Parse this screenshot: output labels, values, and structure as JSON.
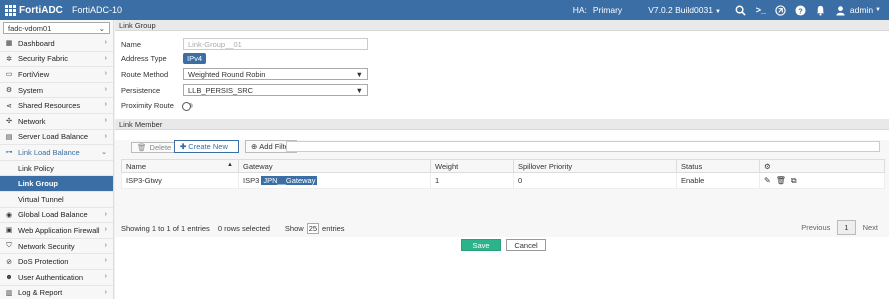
{
  "header": {
    "brand": "FortiADC",
    "product": "FortiADC-10",
    "ha_label": "HA:",
    "ha_value": "Primary",
    "version": "V7.0.2 Build0031",
    "user": "admin"
  },
  "sidebar": {
    "vdom": "fadc-vdom01",
    "items": [
      {
        "label": "Dashboard",
        "icon": "dashboard-icon"
      },
      {
        "label": "Security Fabric",
        "icon": "security-fabric-icon"
      },
      {
        "label": "FortiView",
        "icon": "fortiview-icon"
      },
      {
        "label": "System",
        "icon": "gear-icon"
      },
      {
        "label": "Shared Resources",
        "icon": "share-icon"
      },
      {
        "label": "Network",
        "icon": "network-icon"
      },
      {
        "label": "Server Load Balance",
        "icon": "server-icon"
      },
      {
        "label": "Link Load Balance",
        "icon": "link-icon"
      }
    ],
    "subitems": [
      {
        "label": "Link Policy"
      },
      {
        "label": "Link Group"
      },
      {
        "label": "Virtual Tunnel"
      }
    ],
    "items_after": [
      {
        "label": "Global Load Balance",
        "icon": "globe-icon"
      },
      {
        "label": "Web Application Firewall",
        "icon": "waf-icon"
      },
      {
        "label": "Network Security",
        "icon": "shield-icon"
      },
      {
        "label": "DoS Protection",
        "icon": "dos-icon"
      },
      {
        "label": "User Authentication",
        "icon": "user-icon"
      },
      {
        "label": "Log & Report",
        "icon": "log-icon"
      }
    ]
  },
  "form": {
    "section_title": "Link Group",
    "name_label": "Name",
    "name_placeholder": "Link-Group__01",
    "address_type_label": "Address Type",
    "address_type_value": "IPv4",
    "route_method_label": "Route Method",
    "route_method_value": "Weighted Round Robin",
    "persistence_label": "Persistence",
    "persistence_value": "LLB_PERSIS_SRC",
    "proximity_label": "Proximity Route"
  },
  "link_member": {
    "section_title": "Link Member",
    "delete_label": "Delete",
    "create_label": "Create New",
    "filter_label": "Add Filter",
    "columns": [
      "Name",
      "Gateway",
      "Weight",
      "Spillover Priority",
      "Status"
    ],
    "rows": [
      {
        "name": "ISP3-Gtwy",
        "gateway_prefix": "ISP3",
        "gateway_highlight": "JPN__Gateway",
        "weight": "1",
        "spillover": "0",
        "status": "Enable"
      }
    ],
    "entries_text": "Showing 1 to 1 of 1 entries",
    "selected_text": "0 rows selected",
    "show_label": "Show",
    "show_value": "25",
    "entries_label": "entries",
    "prev_label": "Previous",
    "page": "1",
    "next_label": "Next"
  },
  "actions": {
    "save_label": "Save",
    "cancel_label": "Cancel"
  }
}
